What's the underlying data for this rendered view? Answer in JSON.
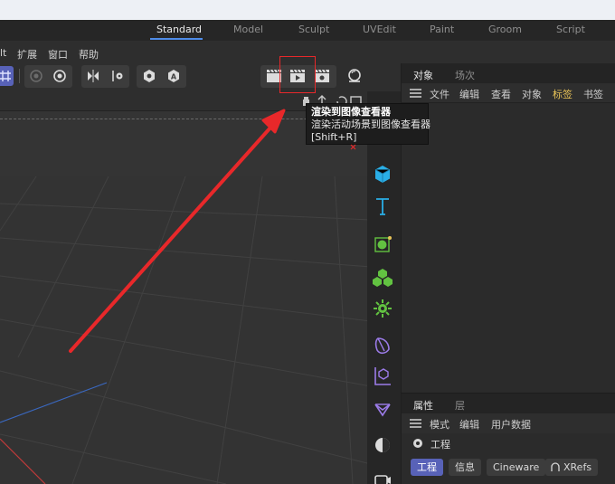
{
  "layouts": {
    "tabs": [
      "Standard",
      "Model",
      "Sculpt",
      "UVEdit",
      "Paint",
      "Groom",
      "Script"
    ],
    "active": "Standard"
  },
  "menubar": {
    "items": [
      "lt",
      "扩展",
      "窗口",
      "帮助"
    ]
  },
  "toolbar": {
    "render_view_icon": "clapper-render-view-icon",
    "render_picture_viewer_icon": "render-to-picture-viewer-icon",
    "render_settings_icon": "render-settings-icon",
    "sphere_icon": "ball-icon"
  },
  "tooltip": {
    "title": "渲染到图像查看器",
    "description": "渲染活动场景到图像查看器",
    "shortcut": "[Shift+R]"
  },
  "object_panel": {
    "tabs": [
      "对象",
      "场次"
    ],
    "active_tab": "对象",
    "menu": [
      "文件",
      "编辑",
      "查看",
      "对象",
      "标签",
      "书签"
    ],
    "highlighted_menu": "标签"
  },
  "attribute_panel": {
    "tabs": [
      "属性",
      "层"
    ],
    "active_tab": "属性",
    "menu": [
      "模式",
      "编辑",
      "用户数据"
    ],
    "title": "工程",
    "buttons": [
      "工程",
      "信息",
      "Cineware",
      "XRefs"
    ],
    "active_button": "工程"
  },
  "colors": {
    "accent_blue": "#4f8ce8",
    "annotation_red": "#e8282a",
    "active_button": "#5862b8",
    "icon_cyan": "#2aaee6",
    "icon_green": "#62c241",
    "icon_purple": "#9b7be8"
  }
}
